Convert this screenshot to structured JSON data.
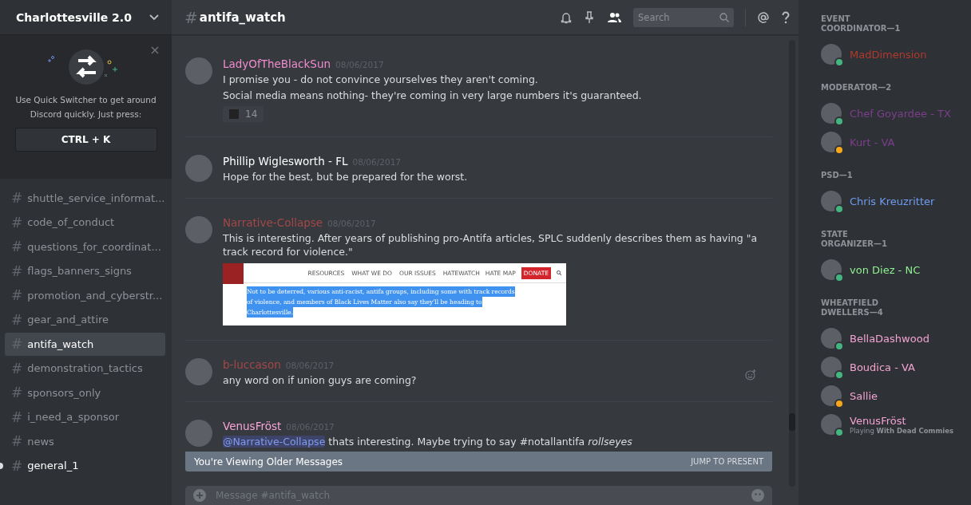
{
  "server": {
    "name": "Charlottesville 2.0"
  },
  "quick_switcher": {
    "text": "Use Quick Switcher to get around Discord quickly. Just press:",
    "shortcut": "CTRL + K"
  },
  "channels": [
    {
      "name": "shuttle_service_informat...",
      "selected": false,
      "unread": false
    },
    {
      "name": "code_of_conduct",
      "selected": false,
      "unread": false
    },
    {
      "name": "questions_for_coordinat...",
      "selected": false,
      "unread": false
    },
    {
      "name": "flags_banners_signs",
      "selected": false,
      "unread": false
    },
    {
      "name": "promotion_and_cyberstr...",
      "selected": false,
      "unread": false
    },
    {
      "name": "gear_and_attire",
      "selected": false,
      "unread": false
    },
    {
      "name": "antifa_watch",
      "selected": true,
      "unread": false
    },
    {
      "name": "demonstration_tactics",
      "selected": false,
      "unread": false
    },
    {
      "name": "sponsors_only",
      "selected": false,
      "unread": false
    },
    {
      "name": "i_need_a_sponsor",
      "selected": false,
      "unread": false
    },
    {
      "name": "news",
      "selected": false,
      "unread": false
    },
    {
      "name": "general_1",
      "selected": false,
      "unread": true
    }
  ],
  "header": {
    "hash": "#",
    "channel": "antifa_watch",
    "search": {
      "placeholder": "Search"
    }
  },
  "messages": [
    {
      "author": "LadyOfTheBlackSun",
      "color": "#f08ccf",
      "time": "08/06/2017",
      "lines": [
        "I promise you - do not convince yourselves they aren't coming.",
        "Social media means nothing- they're coming in very large numbers it's guaranteed."
      ],
      "reaction": {
        "count": "14"
      }
    },
    {
      "author": "Phillip Wiglesworth - FL",
      "color": "#ffffff",
      "time": "08/06/2017",
      "lines": [
        "Hope for the best, but be prepared for the worst."
      ]
    },
    {
      "author": "Narrative-Collapse",
      "color": "#a34848",
      "time": "08/06/2017",
      "lines": [
        "This is interesting. After years of publishing pro-Antifa articles, SPLC suddenly describes them as having \"a track record for violence.\""
      ],
      "embed": {
        "nav": [
          {
            "label": "RESOURCES",
            "kind": "menu"
          },
          {
            "label": "WHAT WE DO",
            "kind": "menu"
          },
          {
            "label": "OUR ISSUES",
            "kind": "menu"
          },
          {
            "label": "HATEWATCH",
            "kind": "link"
          },
          {
            "label": "HATE MAP",
            "kind": "link"
          },
          {
            "label": "DONATE",
            "kind": "donate"
          }
        ],
        "lines": [
          "Not to be deterred, various anti-racist, antifa groups, including some with track records",
          "of violence, and members of  Black Lives Matter also say they'll be heading to",
          "Charlottesville."
        ]
      }
    },
    {
      "author": "b-luccason",
      "color": "#a34848",
      "time": "08/06/2017",
      "lines": [
        "any word on if union guys are coming?"
      ],
      "hovered": true
    },
    {
      "author": "VenusFröst",
      "color": "#f8a4d8",
      "time": "08/06/2017",
      "mention": "@Narrative-Collapse",
      "lines": [
        "thats interesting. Maybe trying to say #notallantifa *rollseyes*"
      ]
    }
  ],
  "older_bar": {
    "text": "You're Viewing Older Messages",
    "action": "JUMP TO PRESENT"
  },
  "composer": {
    "placeholder": "Message #antifa_watch"
  },
  "member_groups": [
    {
      "title": "EVENT COORDINATOR—1",
      "members": [
        {
          "name": "MadDimension",
          "color": "#b03a2e",
          "kind": "online"
        }
      ]
    },
    {
      "title": "MODERATOR—2",
      "members": [
        {
          "name": "Chef Goyardee - TX",
          "color": "#7c3f8c",
          "kind": "online"
        },
        {
          "name": "Kurt - VA",
          "color": "#7c3f8c",
          "kind": "idle"
        }
      ]
    },
    {
      "title": "PSD—1",
      "members": [
        {
          "name": "Chris Kreuzritter",
          "color": "#6f9cf0",
          "kind": "online"
        }
      ]
    },
    {
      "title": "STATE ORGANIZER—1",
      "members": [
        {
          "name": "von Diez - NC",
          "color": "#8ff08f",
          "kind": "online"
        }
      ]
    },
    {
      "title": "WHEATFIELD DWELLERS—4",
      "members": [
        {
          "name": "BellaDashwood",
          "color": "#f3a3d0",
          "kind": "online"
        },
        {
          "name": "Boudica - VA",
          "color": "#f3a3d0",
          "kind": "online"
        },
        {
          "name": "Sallie",
          "color": "#f3a3d0",
          "kind": "idle"
        },
        {
          "name": "VenusFröst",
          "color": "#f3a3d0",
          "kind": "online",
          "activity": "Playing **With Dead Commies**"
        }
      ]
    }
  ]
}
